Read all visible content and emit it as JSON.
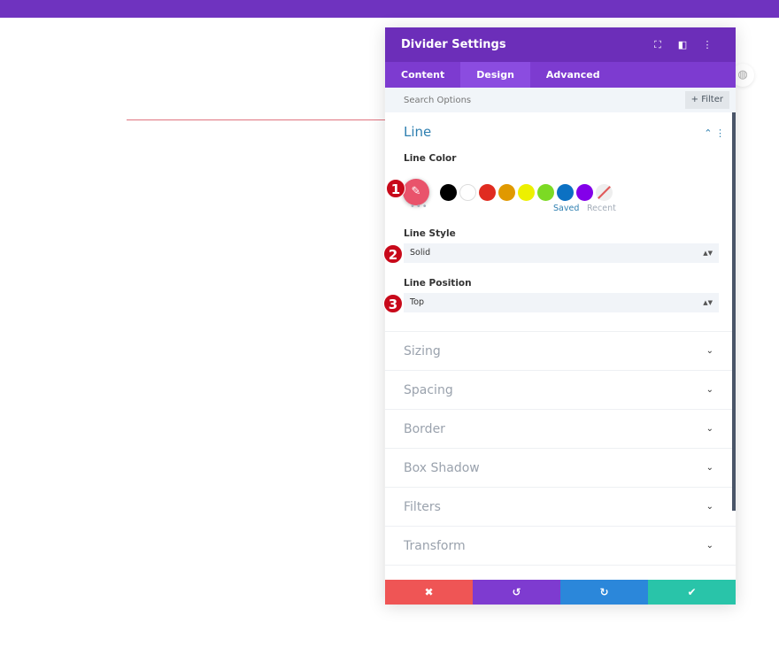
{
  "panel": {
    "title": "Divider Settings",
    "tabs": [
      "Content",
      "Design",
      "Advanced"
    ],
    "active_tab": "Design",
    "search_placeholder": "Search Options",
    "filter_label": "+ Filter"
  },
  "line": {
    "title": "Line",
    "color_label": "Line Color",
    "saved": "Saved",
    "recent": "Recent",
    "swatches": [
      "#000000",
      "#ffffff",
      "#e02b20",
      "#e09900",
      "#edf000",
      "#7cda24",
      "#0c71c3",
      "#8300e9"
    ],
    "selected_color": "#e9536b",
    "style_label": "Line Style",
    "style_value": "Solid",
    "position_label": "Line Position",
    "position_value": "Top"
  },
  "sections": [
    "Sizing",
    "Spacing",
    "Border",
    "Box Shadow",
    "Filters",
    "Transform"
  ],
  "badges": [
    "1",
    "2",
    "3"
  ],
  "colors": {
    "header": "#6c2eb9",
    "cancel": "#ef5555",
    "undo": "#7e3bd0",
    "redo": "#2b87da",
    "save": "#29c4a9"
  }
}
